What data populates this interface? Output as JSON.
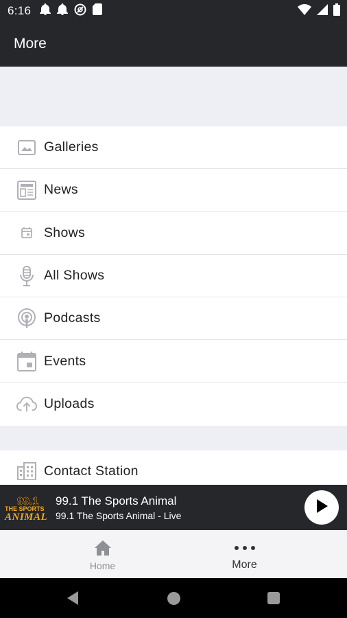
{
  "status_bar": {
    "time": "6:16",
    "left_icons": [
      "notification-bell-icon",
      "notification-bell-icon",
      "do-not-disturb-icon",
      "sd-card-icon"
    ],
    "right_icons": [
      "wifi-icon",
      "cell-signal-icon",
      "battery-icon"
    ]
  },
  "app_bar": {
    "title": "More"
  },
  "menu": {
    "items": [
      {
        "label": "Galleries",
        "icon": "gallery-icon"
      },
      {
        "label": "News",
        "icon": "news-icon"
      },
      {
        "label": "Shows",
        "icon": "calendar-small-icon"
      },
      {
        "label": "All Shows",
        "icon": "microphone-icon"
      },
      {
        "label": "Podcasts",
        "icon": "podcast-icon"
      },
      {
        "label": "Events",
        "icon": "calendar-icon"
      },
      {
        "label": "Uploads",
        "icon": "cloud-upload-icon"
      }
    ],
    "contact": {
      "label": "Contact Station",
      "icon": "building-icon"
    }
  },
  "now_playing": {
    "logo_text": [
      "99.1",
      "THE SPORTS",
      "ANIMAL"
    ],
    "title": "99.1 The Sports Animal",
    "subtitle": "99.1 The Sports Animal - Live",
    "play_icon": "play-icon"
  },
  "bottom_nav": {
    "tabs": [
      {
        "label": "Home",
        "icon": "home-icon",
        "active": false
      },
      {
        "label": "More",
        "icon": "more-dots-icon",
        "active": true
      }
    ]
  },
  "colors": {
    "header_bg": "#25272b",
    "list_bg": "#ffffff",
    "separator_bg": "#eeeff4",
    "icon_gray": "#b0b1b6",
    "logo_orange": "#f5a623"
  }
}
